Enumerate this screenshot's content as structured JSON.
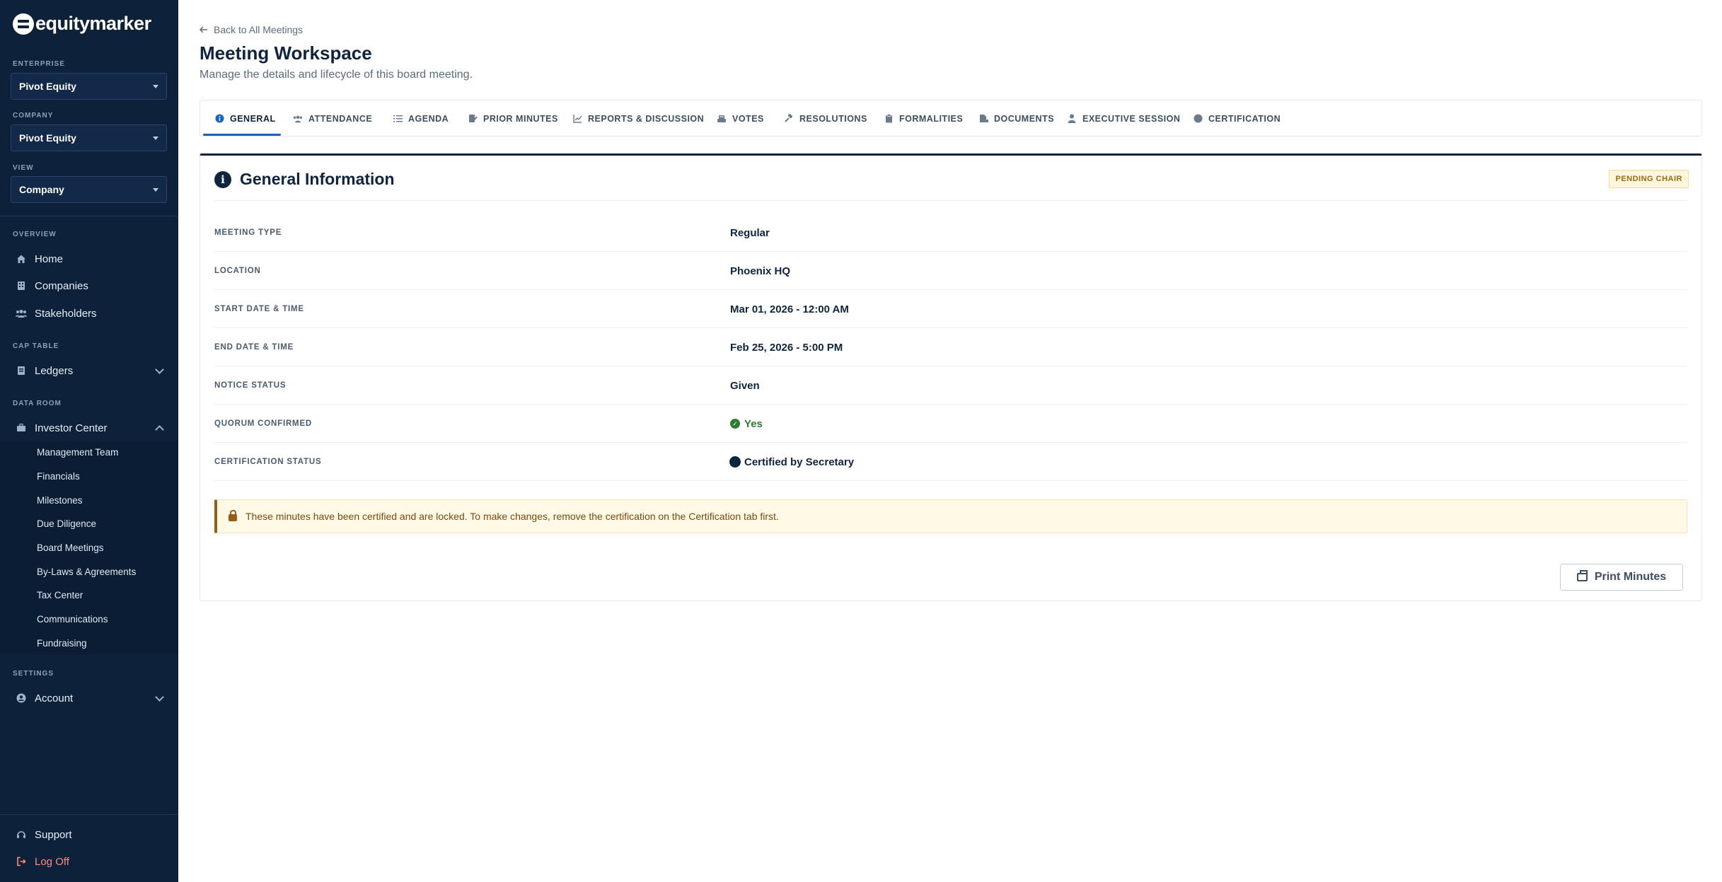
{
  "brand": {
    "name": "equitymarker"
  },
  "sidebar": {
    "enterprise_label": "ENTERPRISE",
    "enterprise_value": "Pivot Equity",
    "company_label": "COMPANY",
    "company_value": "Pivot Equity",
    "view_label": "VIEW",
    "view_value": "Company",
    "sections": {
      "overview": "OVERVIEW",
      "cap_table": "CAP TABLE",
      "data_room": "DATA ROOM",
      "settings": "SETTINGS"
    },
    "items": {
      "home": "Home",
      "companies": "Companies",
      "stakeholders": "Stakeholders",
      "ledgers": "Ledgers",
      "investor_center": "Investor Center",
      "account": "Account",
      "support": "Support",
      "log_off": "Log Off"
    },
    "investor_sub": [
      "Management Team",
      "Financials",
      "Milestones",
      "Due Diligence",
      "Board Meetings",
      "By-Laws & Agreements",
      "Tax Center",
      "Communications",
      "Fundraising"
    ]
  },
  "header": {
    "back": "Back to All Meetings",
    "title": "Meeting Workspace",
    "subtitle": "Manage the details and lifecycle of this board meeting."
  },
  "tabs": [
    "GENERAL",
    "ATTENDANCE",
    "AGENDA",
    "PRIOR MINUTES",
    "REPORTS & DISCUSSION",
    "VOTES",
    "RESOLUTIONS",
    "FORMALITIES",
    "DOCUMENTS",
    "EXECUTIVE SESSION",
    "CERTIFICATION"
  ],
  "card": {
    "title": "General Information",
    "badge": "PENDING CHAIR",
    "rows": [
      {
        "label": "MEETING TYPE",
        "value": "Regular"
      },
      {
        "label": "LOCATION",
        "value": "Phoenix HQ"
      },
      {
        "label": "START DATE & TIME",
        "value": "Mar 01, 2026 - 12:00 AM"
      },
      {
        "label": "END DATE & TIME",
        "value": "Feb 25, 2026 - 5:00 PM"
      },
      {
        "label": "NOTICE STATUS",
        "value": "Given"
      },
      {
        "label": "QUORUM CONFIRMED",
        "value": "Yes"
      },
      {
        "label": "CERTIFICATION STATUS",
        "value": "Certified by Secretary"
      }
    ],
    "alert": "These minutes have been certified and are locked. To make changes, remove the certification on the Certification tab first.",
    "print_label": "Print Minutes"
  },
  "colors": {
    "sidebar_bg": "#0d213b",
    "accent": "#1565c0",
    "success": "#2e7d32",
    "warning": "#9a5b12"
  }
}
